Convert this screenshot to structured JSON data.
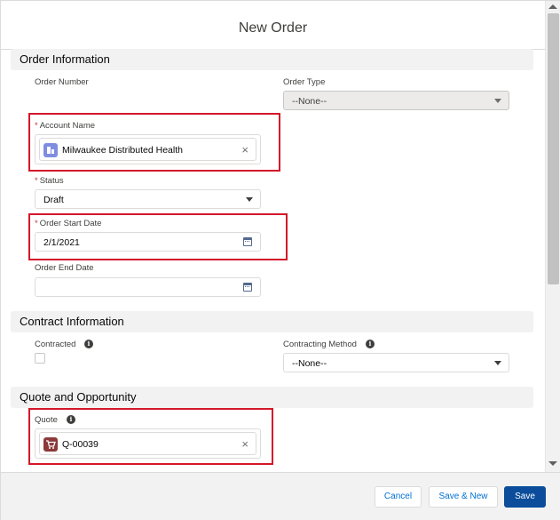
{
  "modal": {
    "title": "New Order"
  },
  "sections": {
    "order_info": {
      "title": "Order Information"
    },
    "contract_info": {
      "title": "Contract Information"
    },
    "quote_opp": {
      "title": "Quote and Opportunity"
    }
  },
  "fields": {
    "order_number": {
      "label": "Order Number"
    },
    "order_type": {
      "label": "Order Type",
      "value": "--None--"
    },
    "account_name": {
      "required": "*",
      "label": "Account Name",
      "value": "Milwaukee Distributed Health",
      "icon": "account-icon"
    },
    "status": {
      "required": "*",
      "label": "Status",
      "value": "Draft"
    },
    "order_start_date": {
      "required": "*",
      "label": "Order Start Date",
      "value": "2/1/2021"
    },
    "order_end_date": {
      "label": "Order End Date",
      "value": ""
    },
    "contracted": {
      "label": "Contracted",
      "checked": false
    },
    "contracting_method": {
      "label": "Contracting Method",
      "value": "--None--"
    },
    "quote": {
      "label": "Quote",
      "value": "Q-00039",
      "icon": "quote-icon"
    }
  },
  "info_glyph": "i",
  "close_glyph": "×",
  "footer": {
    "cancel_label": "Cancel",
    "save_new_label": "Save & New",
    "save_label": "Save"
  },
  "colors": {
    "brand": "#0b4d9b",
    "highlight": "#d4172a",
    "account_icon": "#7f8de1",
    "quote_icon": "#8c3a3a"
  }
}
